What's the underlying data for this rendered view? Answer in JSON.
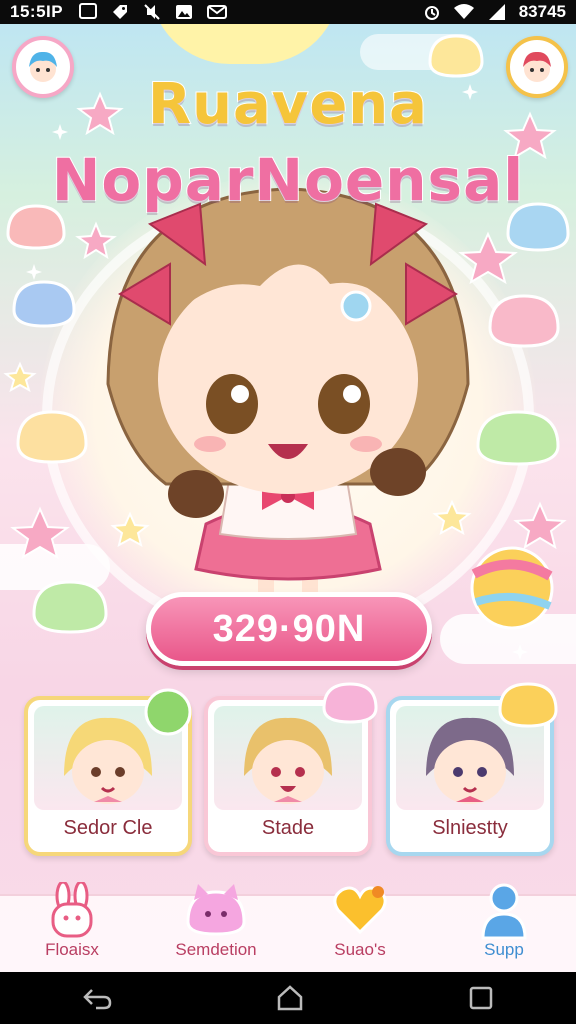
{
  "status_bar": {
    "time": "15:5IP",
    "battery_text": "83745",
    "left_icons": [
      "sim-icon",
      "tag-icon",
      "mute-icon",
      "photo-icon",
      "mail-icon"
    ],
    "right_icons": [
      "alarm-icon",
      "wifi-icon",
      "signal-icon"
    ]
  },
  "game": {
    "title_line1": "Ruavena",
    "title_line2": "NoparNoensal",
    "score": "329·90N",
    "characters": [
      {
        "name": "Sedor Cle"
      },
      {
        "name": "Stade"
      },
      {
        "name": "Slniestty"
      }
    ],
    "corner_left_icon": "blue-hair-avatar-icon",
    "corner_right_icon": "red-hair-avatar-icon"
  },
  "bottom_nav": {
    "items": [
      {
        "label": "Floaisx",
        "icon": "bunny-icon"
      },
      {
        "label": "Semdetion",
        "icon": "cat-blob-icon"
      },
      {
        "label": "Suao's",
        "icon": "heart-icon"
      },
      {
        "label": "Supp",
        "icon": "person-icon"
      }
    ],
    "active_index": 3
  },
  "system_nav": [
    "back-icon",
    "home-icon",
    "recents-icon"
  ],
  "colors": {
    "pink_accent": "#e9578a",
    "card_label": "#8a2d3c",
    "active_nav": "#3f8ed1"
  }
}
